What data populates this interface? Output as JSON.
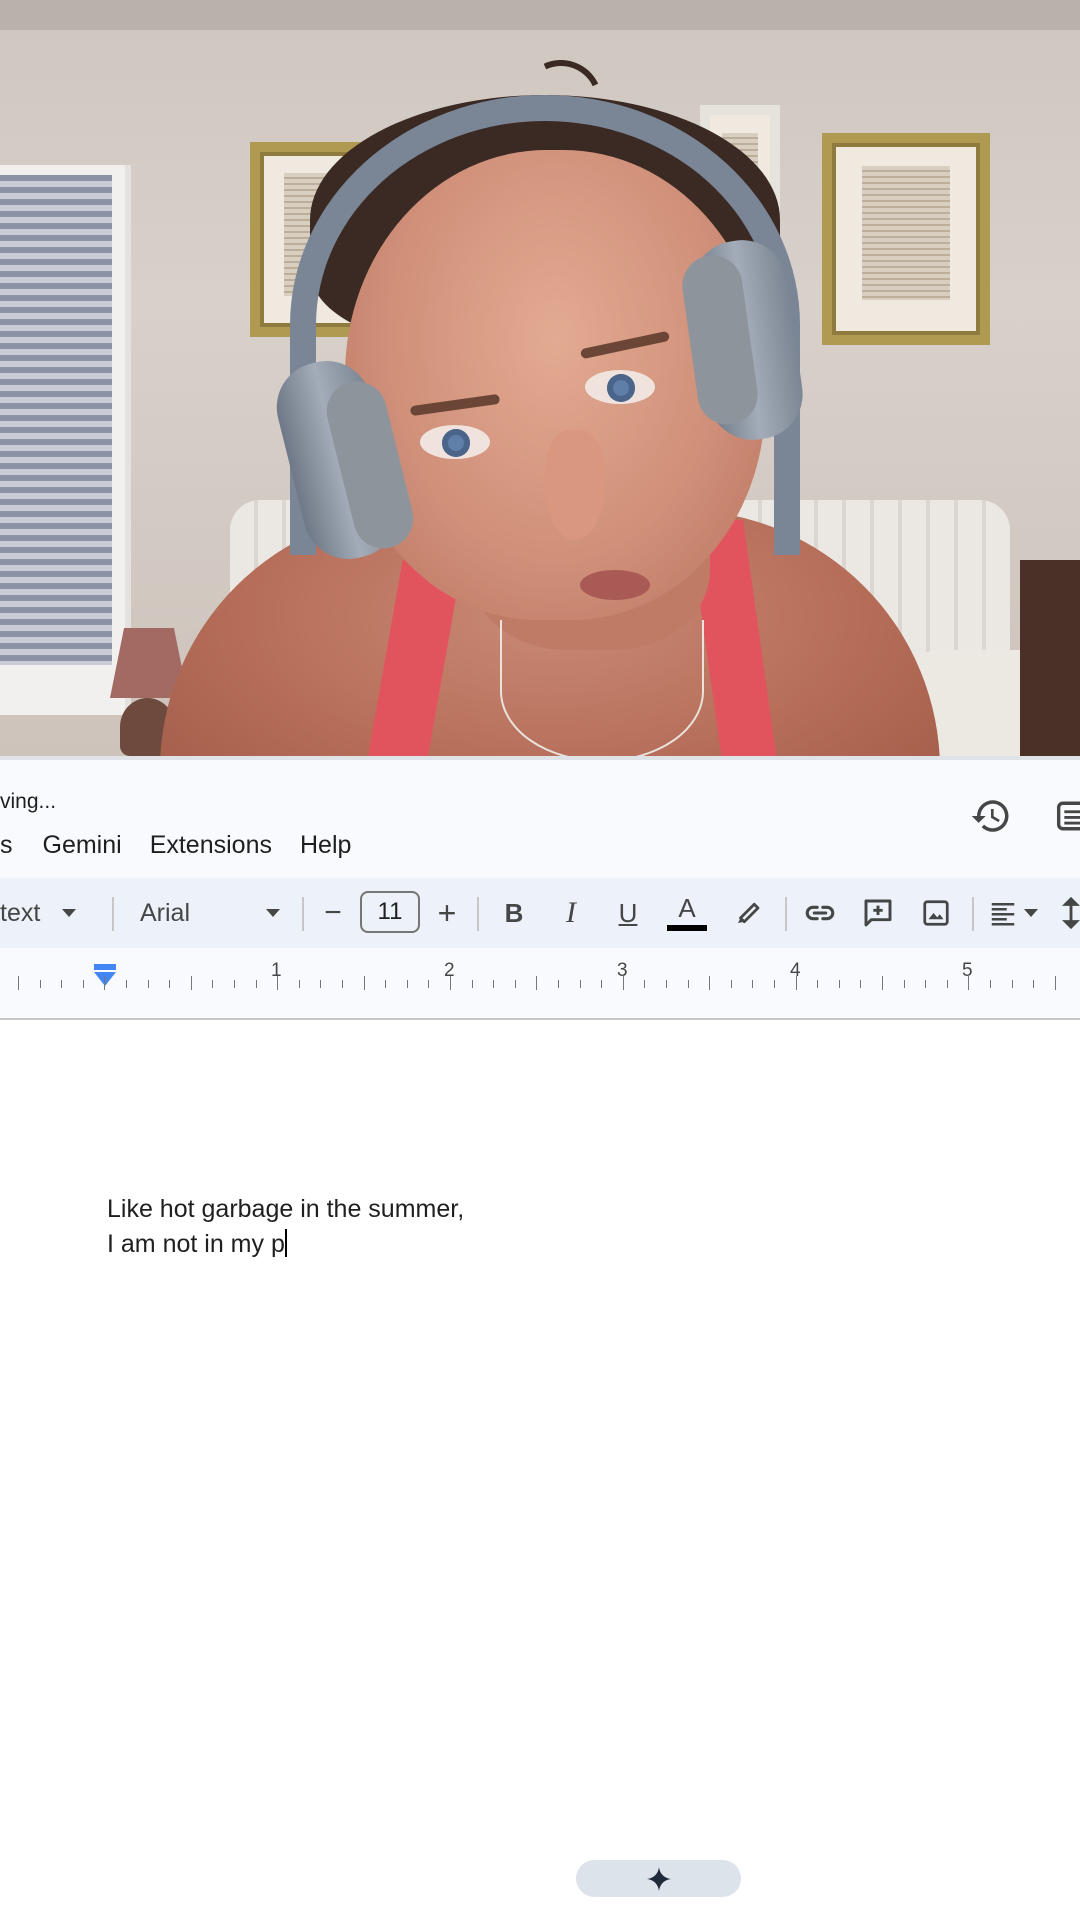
{
  "status": {
    "saving_text": "ving..."
  },
  "menu": {
    "cut_item": "s",
    "items": [
      "Gemini",
      "Extensions",
      "Help"
    ]
  },
  "toolbar": {
    "style_label": "text",
    "font_label": "Arial",
    "font_size": "11",
    "decrease_symbol": "−",
    "increase_symbol": "+",
    "bold": "B",
    "italic": "I",
    "underline": "U",
    "text_color_letter": "A",
    "text_color_hex": "#000000"
  },
  "ruler": {
    "labels": [
      "1",
      "2",
      "3",
      "4",
      "5"
    ]
  },
  "document": {
    "line1": "Like hot garbage in the summer,",
    "line2": "I am not in my p"
  },
  "colors": {
    "chrome_bg": "#f8fafd",
    "toolbar_bg": "#edf2fa",
    "accent_blue": "#4285f4"
  },
  "icons": {
    "history": "history-icon",
    "panel": "side-panel-icon",
    "highlight": "highlighter-icon",
    "link": "link-icon",
    "comment": "add-comment-icon",
    "image": "insert-image-icon",
    "align": "align-left-icon",
    "spacing": "line-spacing-icon",
    "gemini": "gemini-sparkle-icon"
  }
}
